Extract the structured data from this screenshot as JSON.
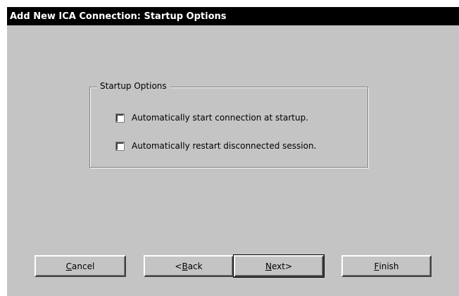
{
  "window": {
    "title": "Add New ICA Connection: Startup Options"
  },
  "startup_options": {
    "group_label": "Startup Options",
    "options": [
      {
        "label": "Automatically start connection at startup.",
        "checked": false
      },
      {
        "label": "Automatically restart disconnected session.",
        "checked": false
      }
    ]
  },
  "buttons": {
    "cancel": {
      "mnemonic": "C",
      "rest": "ancel"
    },
    "back": {
      "prefix": "<",
      "mnemonic": "B",
      "rest": "ack"
    },
    "next": {
      "mnemonic": "N",
      "rest": "ext>"
    },
    "finish": {
      "mnemonic": "F",
      "rest": "inish"
    }
  }
}
